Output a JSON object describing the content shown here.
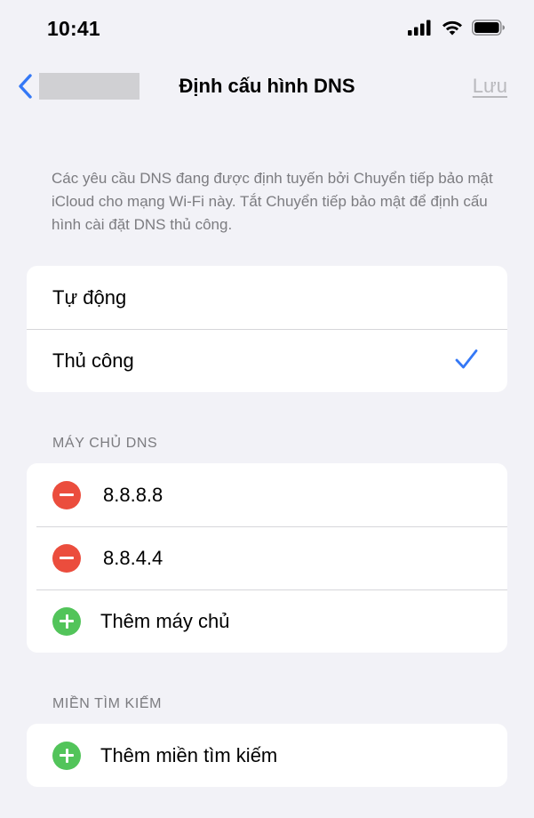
{
  "status_bar": {
    "time": "10:41",
    "icons": [
      "cellular-signal-icon",
      "wifi-icon",
      "battery-icon"
    ]
  },
  "nav": {
    "back_icon": "chevron-left-icon",
    "title": "Định cấu hình DNS",
    "save_label": "Lưu"
  },
  "footnote": "Các yêu cầu DNS đang được định tuyến bởi Chuyển tiếp bảo mật iCloud cho mạng Wi-Fi này. Tắt Chuyển tiếp bảo mật để định cấu hình cài đặt DNS thủ công.",
  "mode_options": {
    "automatic": "Tự động",
    "manual": "Thủ công",
    "selected": "manual"
  },
  "dns_servers": {
    "header": "MÁY CHỦ DNS",
    "servers": [
      "8.8.8.8",
      "8.8.4.4"
    ],
    "add_label": "Thêm máy chủ"
  },
  "search_domains": {
    "header": "MIỀN TÌM KIẾM",
    "add_label": "Thêm miền tìm kiếm"
  },
  "colors": {
    "accent": "#3478f6",
    "delete": "#eb4d3d",
    "add": "#52c45a",
    "disabled": "#b9b9bd",
    "background": "#f2f2f7"
  }
}
